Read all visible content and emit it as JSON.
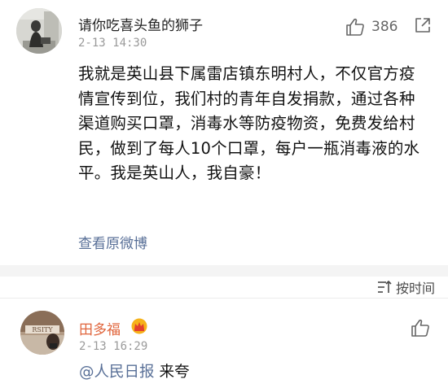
{
  "comments": [
    {
      "username": "请你吃喜头鱼的狮子",
      "time": "2-13 14:30",
      "likes": "386",
      "text": "我就是英山县下属雷店镇东明村人，不仅官方疫情宣传到位，我们村的青年自发捐款，通过各种渠道购买口罩，消毒水等防疫物资，免费发给村民，做到了每人10个口罩，每户一瓶消毒液的水平。我是英山人，我自豪！",
      "view_original": "查看原微博",
      "avatar_icon": "avatar-photo"
    },
    {
      "username": "田多福",
      "time": "2-13 16:29",
      "mention": "@人民日报",
      "reply": "来夸",
      "badge_icon": "crown-icon",
      "avatar_icon": "avatar-photo"
    }
  ],
  "sort": {
    "label": "按时间",
    "icon": "sort-icon"
  },
  "icons": {
    "like": "thumbs-up-icon",
    "share": "share-icon"
  },
  "colors": {
    "link": "#586f97",
    "username_highlight": "#e0643b",
    "muted": "#9a9a9a",
    "separator": "#f4f4f4"
  }
}
